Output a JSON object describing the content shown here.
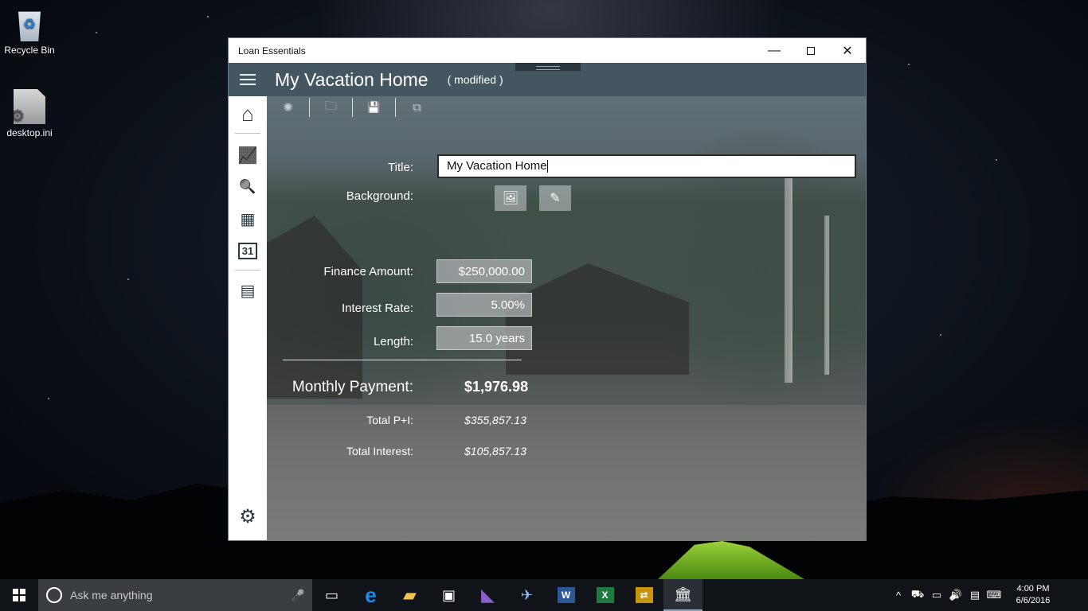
{
  "desktop": {
    "icons": [
      {
        "label": "Recycle Bin",
        "icon": "recycle-bin-icon"
      },
      {
        "label": "desktop.ini",
        "icon": "settings-file-icon"
      }
    ]
  },
  "window": {
    "title": "Loan Essentials",
    "controls": {
      "minimize": "—",
      "close": "✕"
    }
  },
  "appbar": {
    "title": "My Vacation Home",
    "status": "( modified )"
  },
  "sidebar": {
    "items": [
      {
        "name": "home",
        "glyph": "⌂"
      },
      {
        "name": "chart",
        "glyph": "📈"
      },
      {
        "name": "document-search",
        "glyph": "🔍"
      },
      {
        "name": "calendar",
        "glyph": "▦"
      },
      {
        "name": "calendar-31",
        "glyph": "31"
      },
      {
        "name": "calculator",
        "glyph": "▤"
      },
      {
        "name": "settings",
        "glyph": "⚙"
      }
    ]
  },
  "toolbar": {
    "items": [
      {
        "name": "new",
        "glyph": "✺"
      },
      {
        "name": "open",
        "glyph": "🗀"
      },
      {
        "name": "save",
        "glyph": "💾"
      },
      {
        "name": "copy",
        "glyph": "⧉"
      }
    ]
  },
  "form": {
    "title_label": "Title:",
    "title_value": "My Vacation Home",
    "background_label": "Background:",
    "background_buttons": [
      {
        "name": "picture",
        "glyph": "🖼"
      },
      {
        "name": "fill",
        "glyph": "✎"
      }
    ],
    "finance_label": "Finance Amount:",
    "finance_value": "$250,000.00",
    "rate_label": "Interest Rate:",
    "rate_value": "5.00%",
    "length_label": "Length:",
    "length_value": "15.0 years"
  },
  "results": {
    "monthly_label": "Monthly Payment:",
    "monthly_value": "$1,976.98",
    "total_pi_label": "Total P+I:",
    "total_pi_value": "$355,857.13",
    "total_interest_label": "Total Interest:",
    "total_interest_value": "$105,857.13"
  },
  "taskbar": {
    "search_placeholder": "Ask me anything",
    "apps": [
      {
        "name": "task-view",
        "glyph": "▭",
        "color": "#ffffff"
      },
      {
        "name": "edge",
        "glyph": "e",
        "color": "#1e88e5"
      },
      {
        "name": "file-explorer",
        "glyph": "▰",
        "color": "#f2c14e"
      },
      {
        "name": "store",
        "glyph": "▣",
        "color": "#ffffff"
      },
      {
        "name": "visual-studio",
        "glyph": "◣",
        "color": "#8a5ec7"
      },
      {
        "name": "photos-app",
        "glyph": "✈",
        "color": "#7fc2ff"
      },
      {
        "name": "word",
        "glyph": "W",
        "color": "#2b5797"
      },
      {
        "name": "excel",
        "glyph": "X",
        "color": "#1f7a3f"
      },
      {
        "name": "yellow-app",
        "glyph": "⇄",
        "color": "#c8940a"
      },
      {
        "name": "loan-essentials",
        "glyph": "🏛",
        "color": "#ffffff"
      }
    ],
    "tray": [
      "^",
      "⛟",
      "▭",
      "🔊",
      "▤",
      "⌨"
    ],
    "time": "4:00 PM",
    "date": "6/6/2016"
  }
}
